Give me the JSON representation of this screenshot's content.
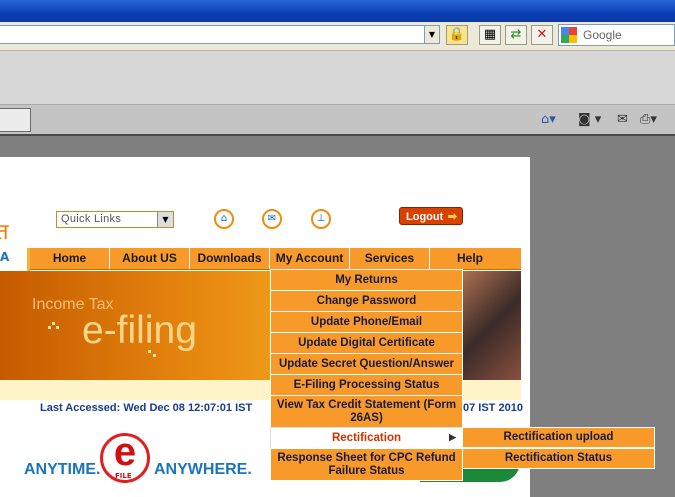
{
  "browser": {
    "search_placeholder": "Google",
    "icons": [
      "lock-icon",
      "certificate-icon",
      "refresh-icon",
      "stop-icon",
      "home-icon",
      "rss-icon",
      "mail-icon",
      "print-icon"
    ]
  },
  "site": {
    "quick_links": "Quick Links",
    "logout_label": "Logout",
    "nav": [
      "Home",
      "About US",
      "Downloads",
      "My Account",
      "Services",
      "Help"
    ],
    "banner_small": "Income Tax",
    "banner_big": "e-filing",
    "last_accessed_label": "Last Accessed:",
    "last_accessed_value": "Wed Dec 08 12:07:01 IST",
    "last_accessed_right": "07 IST 2010",
    "tagline_left": "ANYTIME.",
    "tagline_right": "ANYWHERE.",
    "logo_e": "e",
    "logo_file": "FILE"
  },
  "menu": {
    "items": [
      "My Returns",
      "Change Password",
      "Update Phone/Email",
      "Update Digital Certificate",
      "Update Secret Question/Answer",
      "E-Filing Processing Status",
      "View Tax Credit Statement (Form 26AS)",
      "Rectification",
      "Response Sheet for CPC Refund Failure Status"
    ],
    "submenu": [
      "Rectification upload",
      "Rectification Status"
    ]
  },
  "colors": {
    "accent": "#f79a2a",
    "brand_blue": "#1b75bb",
    "highlight_text": "#cc3300"
  }
}
